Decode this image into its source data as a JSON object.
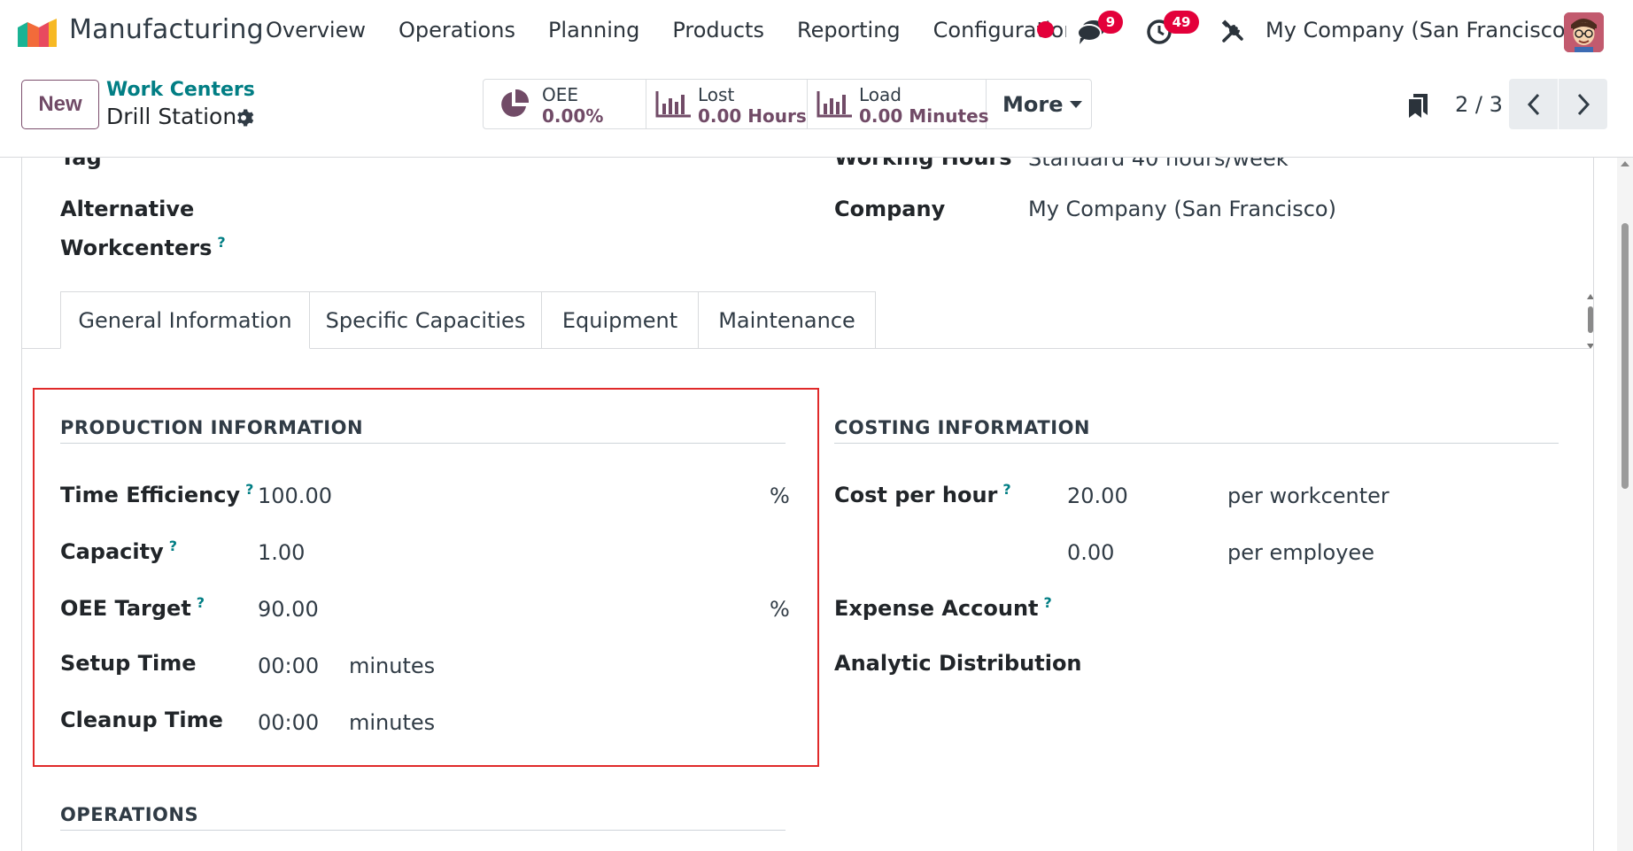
{
  "navbar": {
    "app_name": "Manufacturing",
    "menu": [
      "Overview",
      "Operations",
      "Planning",
      "Products",
      "Reporting",
      "Configuration"
    ],
    "messages_badge": "9",
    "activities_badge": "49",
    "company": "My Company (San Francisco)"
  },
  "control": {
    "new_label": "New",
    "breadcrumb_parent": "Work Centers",
    "breadcrumb_current": "Drill Station",
    "stats": [
      {
        "label": "OEE",
        "value": "0.00%"
      },
      {
        "label": "Lost",
        "value": "0.00 Hours"
      },
      {
        "label": "Load",
        "value": "0.00 Minutes"
      }
    ],
    "more_label": "More",
    "pager": "2 / 3"
  },
  "form": {
    "tag_label": "Tag",
    "working_hours_label": "Working Hours",
    "working_hours_value": "Standard 40 hours/week",
    "alternative_label_line1": "Alternative",
    "alternative_label_line2": "Workcenters",
    "company_label": "Company",
    "company_value": "My Company (San Francisco)"
  },
  "tabs": [
    "General Information",
    "Specific Capacities",
    "Equipment",
    "Maintenance"
  ],
  "production": {
    "title": "PRODUCTION INFORMATION",
    "time_efficiency_label": "Time Efficiency",
    "time_efficiency_value": "100.00",
    "capacity_label": "Capacity",
    "capacity_value": "1.00",
    "oee_target_label": "OEE Target",
    "oee_target_value": "90.00",
    "setup_time_label": "Setup Time",
    "setup_time_value": "00:00",
    "cleanup_time_label": "Cleanup Time",
    "cleanup_time_value": "00:00",
    "percent_unit": "%",
    "minutes_unit": "minutes"
  },
  "costing": {
    "title": "COSTING INFORMATION",
    "cost_per_hour_label": "Cost per hour",
    "cost_per_hour_value": "20.00",
    "per_workcenter": "per workcenter",
    "employee_cost_value": "0.00",
    "per_employee": "per employee",
    "expense_account_label": "Expense Account",
    "analytic_distribution_label": "Analytic Distribution"
  },
  "operations": {
    "title": "OPERATIONS"
  },
  "help_mark": "?",
  "colors": {
    "brand": "#714b67",
    "link": "#017e84",
    "badge": "#e3003a",
    "highlight": "#e02a2a"
  }
}
